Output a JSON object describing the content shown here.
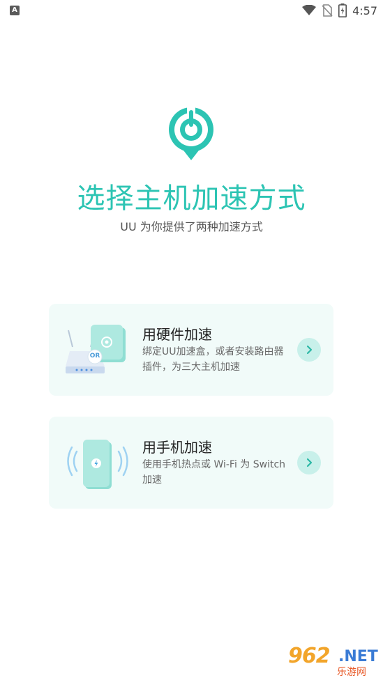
{
  "status_bar": {
    "left_icon_letter": "A",
    "time": "4:57",
    "icons": [
      "wifi-icon",
      "no-sim-icon",
      "battery-charging-icon"
    ]
  },
  "header": {
    "logo_icon": "uu-logo-icon",
    "title": "选择主机加速方式",
    "subtitle": "UU 为你提供了两种加速方式"
  },
  "options": [
    {
      "title": "用硬件加速",
      "description": "绑定UU加速盒，或者安装路由器插件，为三大主机加速",
      "illustration_badge": "OR",
      "icon": "router-box-icon",
      "arrow_icon": "chevron-right-icon"
    },
    {
      "title": "用手机加速",
      "description": "使用手机热点或 Wi-Fi 为 Switch 加速",
      "icon": "phone-hotspot-icon",
      "arrow_icon": "chevron-right-icon"
    }
  ],
  "watermark": {
    "number": "962",
    "suffix": ".NET",
    "chinese": "乐游网"
  },
  "colors": {
    "accent": "#2cc4b3",
    "card_bg": "#f1fbf9",
    "arrow_bg": "#c8f0ea"
  }
}
